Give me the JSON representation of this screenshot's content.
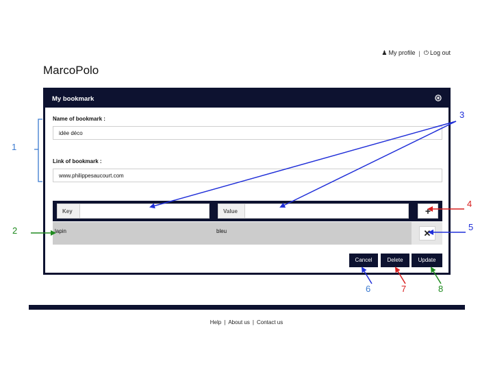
{
  "header": {
    "my_profile": "My profile",
    "separator": "|",
    "logout": "Log out",
    "brand": "MarcoPolo"
  },
  "panel": {
    "title": "My bookmark",
    "name_label": "Name of bookmark :",
    "name_value": "idée déco",
    "link_label": "Link of bookmark :",
    "link_value": "www.philippesaucourt.com",
    "key_tag": "Key",
    "value_tag": "Value",
    "add_button": "+",
    "rows": [
      {
        "key": "lapin",
        "value": "bleu",
        "remove": "✕"
      }
    ],
    "buttons": {
      "cancel": "Cancel",
      "delete": "Delete",
      "update": "Update"
    }
  },
  "footer": {
    "links": [
      "Help",
      "About us",
      "Contact us"
    ],
    "separator": "|"
  },
  "annotations": {
    "n1": "1",
    "n2": "2",
    "n3": "3",
    "n4": "4",
    "n5": "5",
    "n6": "6",
    "n7": "7",
    "n8": "8"
  },
  "colors": {
    "navy": "#0d1230",
    "blue_annotation": "#1f2ed8",
    "light_blue_annotation": "#3a7ad0",
    "red_annotation": "#d81e1e",
    "green_annotation": "#1e8a1e"
  }
}
